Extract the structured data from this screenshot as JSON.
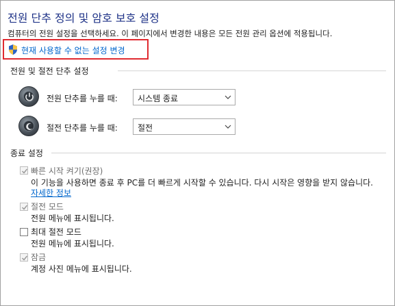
{
  "page": {
    "title": "전원 단추 정의 및 암호 보호 설정",
    "description": "컴퓨터의 전원 설정을 선택하세요. 이 페이지에서 변경한 내용은 모든 전원 관리 옵션에 적용됩니다.",
    "change_link": "현재 사용할 수 없는 설정 변경"
  },
  "power_section": {
    "title": "전원 및 절전 단추 설정",
    "rows": [
      {
        "label": "전원 단추를 누를 때:",
        "value": "시스템 종료",
        "icon": "power-button-icon"
      },
      {
        "label": "절전 단추를 누를 때:",
        "value": "절전",
        "icon": "sleep-button-icon"
      }
    ]
  },
  "shutdown_section": {
    "title": "종료 설정",
    "items": [
      {
        "label": "빠른 시작 켜기(권장)",
        "checked": true,
        "enabled": false,
        "description": "이 기능을 사용하면 종료 후 PC를 더 빠르게 시작할 수 있습니다. 다시 시작은 영향을 받지 않습니다.",
        "link": "자세한 정보"
      },
      {
        "label": "절전 모드",
        "checked": true,
        "enabled": false,
        "description": "전원 메뉴에 표시됩니다."
      },
      {
        "label": "최대 절전 모드",
        "checked": false,
        "enabled": true,
        "description": "전원 메뉴에 표시됩니다."
      },
      {
        "label": "잠금",
        "checked": true,
        "enabled": false,
        "description": "계정 사진 메뉴에 표시됩니다."
      }
    ]
  },
  "colors": {
    "title": "#1e3287",
    "link": "#0066cc",
    "highlight_border": "#e0292f",
    "disabled_text": "#6d6d6d"
  }
}
